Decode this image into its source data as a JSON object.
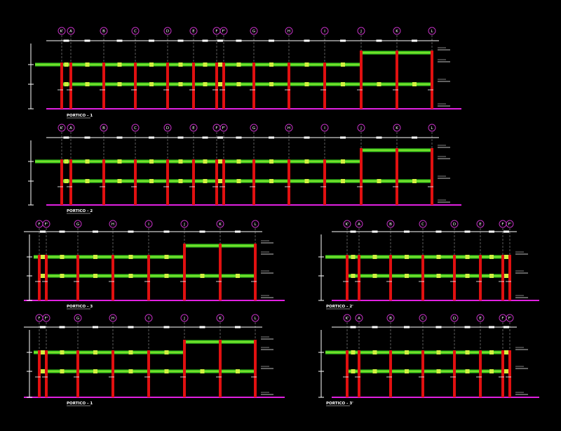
{
  "colors": {
    "background": "#000000",
    "ground": "#e020e0",
    "column": "#e01010",
    "beam": "#40d020",
    "beam_hatch": "#d0f040",
    "grid_line": "#ffffff",
    "axis_bubble": "#c030c0",
    "dimension": "#ffffff"
  },
  "frames": [
    {
      "id": "portico-1",
      "title": "PORTICO - 1",
      "axes": [
        "K'",
        "A",
        "B",
        "C",
        "D",
        "E",
        "F",
        "F'",
        "G",
        "H",
        "I",
        "J",
        "K",
        "L"
      ]
    },
    {
      "id": "portico-2",
      "title": "PORTICO - 2",
      "axes": [
        "K'",
        "A",
        "B",
        "C",
        "D",
        "E",
        "F",
        "F'",
        "G",
        "H",
        "I",
        "J",
        "K",
        "L"
      ]
    },
    {
      "id": "portico-3",
      "title": "PORTICO - 3",
      "axes": [
        "F",
        "F'",
        "G",
        "H",
        "I",
        "J",
        "K",
        "L"
      ]
    },
    {
      "id": "portico-2b",
      "title": "PORTICO - 2'",
      "axes": [
        "K'",
        "A",
        "B",
        "C",
        "D",
        "E",
        "F",
        "F'"
      ]
    },
    {
      "id": "portico-4",
      "title": "PORTICO - 1",
      "axes": [
        "F",
        "F'",
        "G",
        "H",
        "I",
        "J",
        "K",
        "L"
      ]
    },
    {
      "id": "portico-3b",
      "title": "PORTICO - 3'",
      "axes": [
        "K'",
        "A",
        "B",
        "C",
        "D",
        "E",
        "F",
        "F'"
      ]
    }
  ]
}
